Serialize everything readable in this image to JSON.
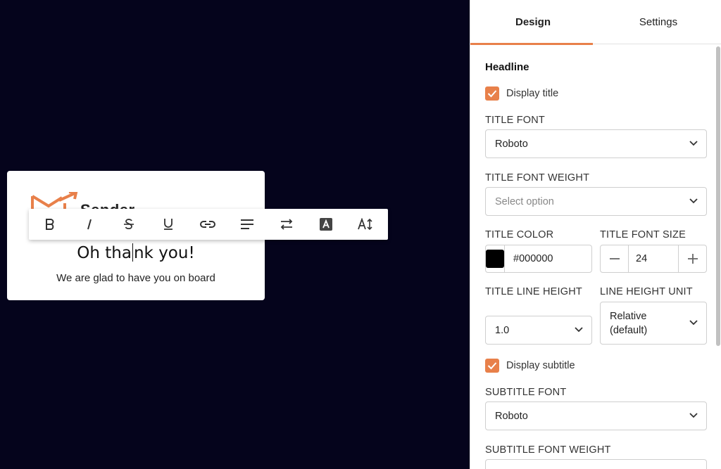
{
  "canvas": {
    "logo_text": "Sender",
    "title_before_cursor": "Oh tha",
    "title_after_cursor": "nk you!",
    "subtitle": "We are glad to have you on board"
  },
  "toolbar": {
    "buttons": [
      {
        "name": "bold-icon",
        "glyph": "B"
      },
      {
        "name": "italic-icon",
        "glyph": "I"
      },
      {
        "name": "strikethrough-icon",
        "glyph": "S"
      },
      {
        "name": "underline-icon",
        "glyph": "U"
      },
      {
        "name": "link-icon",
        "glyph": "link"
      },
      {
        "name": "align-left-icon",
        "glyph": "align"
      },
      {
        "name": "text-direction-icon",
        "glyph": "swap"
      },
      {
        "name": "text-color-icon",
        "glyph": "A"
      },
      {
        "name": "font-size-icon",
        "glyph": "A↕"
      }
    ]
  },
  "panel": {
    "tabs": [
      {
        "label": "Design",
        "active": true
      },
      {
        "label": "Settings",
        "active": false
      }
    ],
    "section_title": "Headline",
    "display_title_label": "Display title",
    "title_font_label": "TITLE FONT",
    "title_font_value": "Roboto",
    "title_font_weight_label": "TITLE FONT WEIGHT",
    "title_font_weight_placeholder": "Select option",
    "title_color_label": "TITLE COLOR",
    "title_color_value": "#000000",
    "title_font_size_label": "TITLE FONT SIZE",
    "title_font_size_value": "24",
    "title_line_height_label": "TITLE LINE HEIGHT",
    "title_line_height_value": "1.0",
    "line_height_unit_label": "LINE HEIGHT UNIT",
    "line_height_unit_value_1": "Relative",
    "line_height_unit_value_2": "(default)",
    "display_subtitle_label": "Display subtitle",
    "subtitle_font_label": "SUBTITLE FONT",
    "subtitle_font_value": "Roboto",
    "subtitle_font_weight_label": "SUBTITLE FONT WEIGHT"
  },
  "colors": {
    "canvas_background": "#05041c",
    "accent": "#e8804a",
    "swatch": "#000000"
  }
}
